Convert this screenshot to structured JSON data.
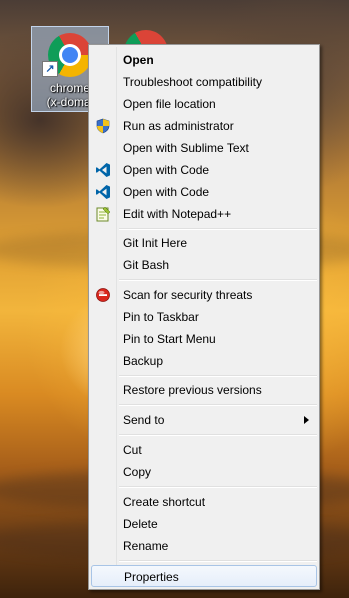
{
  "desktop": {
    "icon": {
      "label_line1": "chrome",
      "label_line2": "(x-domai"
    }
  },
  "menu": {
    "items": [
      {
        "label": "Open",
        "bold": true,
        "icon": null
      },
      {
        "label": "Troubleshoot compatibility",
        "icon": null
      },
      {
        "label": "Open file location",
        "icon": null
      },
      {
        "label": "Run as administrator",
        "icon": "uac-shield-icon"
      },
      {
        "label": "Open with Sublime Text",
        "icon": null
      },
      {
        "label": "Open with Code",
        "icon": "vscode-icon"
      },
      {
        "label": "Open with Code",
        "icon": "vscode-icon"
      },
      {
        "label": "Edit with Notepad++",
        "icon": "notepadpp-icon"
      },
      {
        "label": "Git Init Here",
        "icon": null
      },
      {
        "label": "Git Bash",
        "icon": null
      },
      {
        "label": "Scan for security threats",
        "icon": "antivirus-icon"
      },
      {
        "label": "Pin to Taskbar",
        "icon": null
      },
      {
        "label": "Pin to Start Menu",
        "icon": null
      },
      {
        "label": "Backup",
        "icon": null
      },
      {
        "label": "Restore previous versions",
        "icon": null
      },
      {
        "label": "Send to",
        "icon": null,
        "submenu": true
      },
      {
        "label": "Cut",
        "icon": null
      },
      {
        "label": "Copy",
        "icon": null
      },
      {
        "label": "Create shortcut",
        "icon": null
      },
      {
        "label": "Delete",
        "icon": null
      },
      {
        "label": "Rename",
        "icon": null
      },
      {
        "label": "Properties",
        "icon": null,
        "highlighted": true
      }
    ]
  },
  "colors": {
    "menu_bg": "#f0f0f0",
    "hover_border": "#a8c4e6",
    "vscode_blue": "#0065a9",
    "antivirus_red": "#d9261c"
  }
}
